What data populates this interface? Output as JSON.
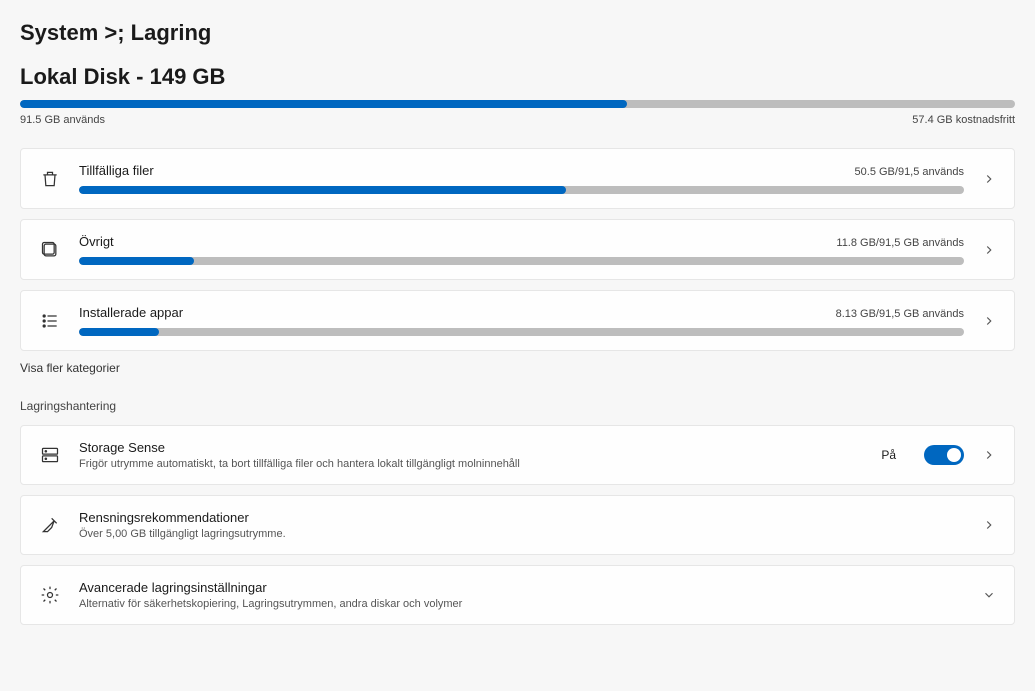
{
  "breadcrumb": "System >;  Lagring",
  "disk_title": "Lokal   Disk - 149 GB",
  "main_bar_percent": 61,
  "used_label": "91.5 GB används",
  "free_label": "57.4 GB kostnadsfritt",
  "categories": [
    {
      "icon": "trash",
      "title": "Tillfälliga filer",
      "stat": "50.5 GB/91,5 används",
      "percent": 55
    },
    {
      "icon": "box",
      "title": "Övrigt",
      "stat": "11.8 GB/91,5 GB används",
      "percent": 13
    },
    {
      "icon": "list",
      "title": "Installerade appar",
      "stat": "8.13 GB/91,5 GB används",
      "percent": 9
    }
  ],
  "show_more": "Visa fler kategorier",
  "mgmt_heading": "Lagringshantering",
  "storage_sense": {
    "title": "Storage Sense",
    "desc": "Frigör utrymme automatiskt, ta bort tillfälliga filer och hantera lokalt tillgängligt molninnehåll",
    "state_label": "På",
    "on": true
  },
  "cleanup": {
    "title": "Rensningsrekommendationer",
    "desc": "Över 5,00 GB tillgängligt lagringsutrymme."
  },
  "advanced": {
    "title": "Avancerade lagringsinställningar",
    "desc": "Alternativ för säkerhetskopiering, Lagringsutrymmen, andra diskar och volymer"
  },
  "chart_data": {
    "type": "bar",
    "title": "Lokal Disk - 149 GB",
    "total_gb": 149,
    "used_gb": 91.5,
    "free_gb": 57.4,
    "breakdown": [
      {
        "name": "Tillfälliga filer",
        "used_gb": 50.5,
        "total_gb": 91.5
      },
      {
        "name": "Övrigt",
        "used_gb": 11.8,
        "total_gb": 91.5
      },
      {
        "name": "Installerade appar",
        "used_gb": 8.13,
        "total_gb": 91.5
      }
    ]
  }
}
